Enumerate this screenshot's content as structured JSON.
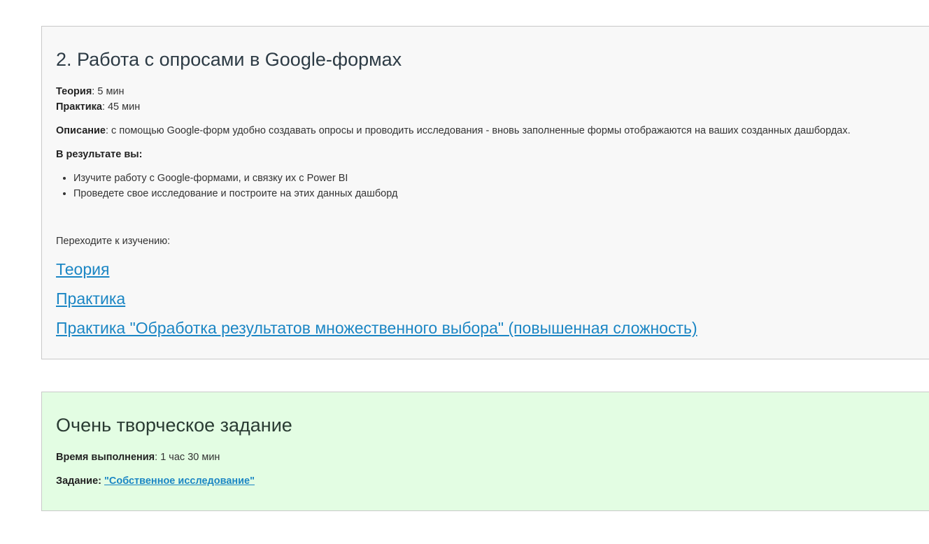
{
  "module": {
    "title": "2. Работа с опросами в Google-формах",
    "theory_label": "Теория",
    "theory_value": ": 5 мин",
    "practice_label": "Практика",
    "practice_value": ": 45 мин",
    "description_label": "Описание",
    "description_value": ": с помощью Google-форм удобно создавать опросы и проводить исследования - вновь заполненные формы отображаются на ваших созданных дашбордах.",
    "result_label": "В результате вы:",
    "results": [
      "Изучите работу с Google-формами, и связку их с Power BI",
      "Проведете свое исследование и построите на этих данных дашборд"
    ],
    "goto_text": "Переходите к изучению:",
    "links": [
      "Теория",
      "Практика",
      "Практика \"Обработка результатов множественного выбора\" (повышенная сложность)"
    ]
  },
  "creative": {
    "title": "Очень творческое задание",
    "time_label": "Время выполнения",
    "time_value": ": 1 час 30 мин",
    "task_label": "Задание:",
    "task_link": "\"Собственное исследование\""
  },
  "colors": {
    "module_bg": "#f8f8f8",
    "creative_bg": "#e3fde3",
    "link": "#1b86c4"
  }
}
